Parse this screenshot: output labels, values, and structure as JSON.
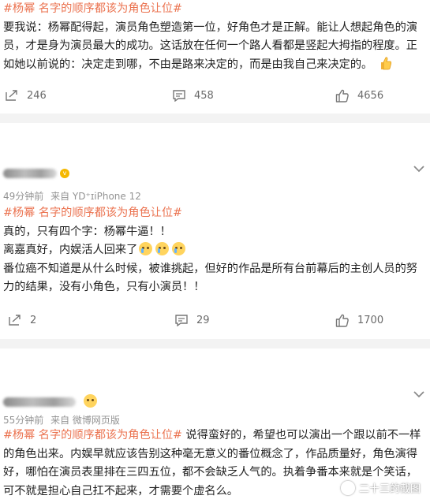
{
  "posts": [
    {
      "tag": "#杨幂 名字的顺序都该为角色让位#",
      "body": "要我说：杨幂配得起，演员角色塑造第一位，好角色才是正解。能让人想起角色的演员，才是身为演员最大的成功。这话放在任何一个路人看都是竖起大拇指的程度。正如她以前说的：决定走到哪，不由是路来决定的，而是由我自己来决定的。",
      "emoji": "thumbs-up-emoji",
      "actions": {
        "repost": "246",
        "comment": "458",
        "like": "4656"
      }
    },
    {
      "meta": {
        "time": "49分钟前",
        "from": "来自 YD⁺ɪiPhone 12"
      },
      "tag": "#杨幂 名字的顺序都该为角色让位#",
      "line1": "真的，只有四个字：杨幂牛逼！！",
      "line2": "离嘉真好，内娱活人回来了",
      "line3": "番位癌不知道是从什么时候，被谁挑起，但好的作品是所有台前幕后的主创人员的努力的结果，没有小角色，只有小演员！！",
      "emoji": "crying-emoji",
      "actions": {
        "repost": "2",
        "comment": "29",
        "like": "1700"
      }
    },
    {
      "meta": {
        "time": "55分钟前",
        "from": "来自 微博网页版"
      },
      "tag": "#杨幂 名字的顺序都该为角色让位#",
      "body": " 说得蛮好的，希望也可以演出一个跟以前不一样的角色出来。内娱早就应该告别这种毫无意义的番位概念了，作品质量好，角色演得好，哪怕在演员表里排在三四五位，都不会缺乏人气的。执着争番本来就是个笑话，可不就是担心自己扛不起来，才需要个虚名么。"
    }
  ],
  "watermark": "二十三的截图",
  "colors": {
    "tag": "#eb7350",
    "meta": "#939393",
    "separator": "#f3f3f3"
  },
  "icons": [
    "repost-icon",
    "comment-icon",
    "like-icon",
    "chevron-down-icon",
    "vip-badge-icon"
  ]
}
